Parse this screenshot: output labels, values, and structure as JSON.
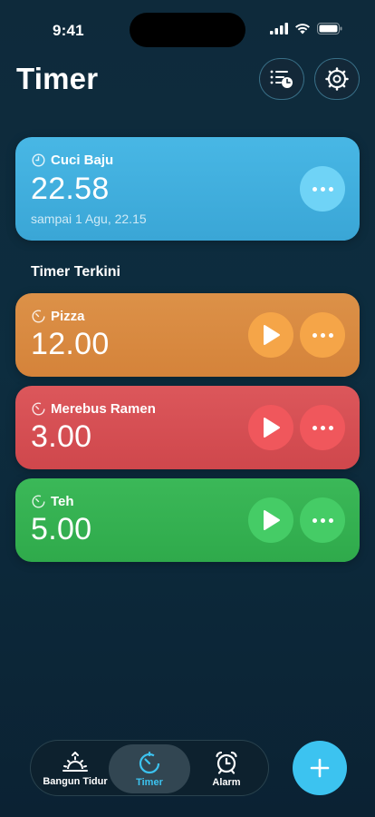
{
  "status_bar": {
    "time": "9:41"
  },
  "header": {
    "title": "Timer"
  },
  "active_timer": {
    "label": "Cuci Baju",
    "value": "22.58",
    "until": "sampai 1 Agu, 22.15",
    "color": "#3aa6d6"
  },
  "recent": {
    "title": "Timer Terkini",
    "items": [
      {
        "label": "Pizza",
        "value": "12.00",
        "color": "#d88a3e"
      },
      {
        "label": "Merebus Ramen",
        "value": "3.00",
        "color": "#d64d52"
      },
      {
        "label": "Teh",
        "value": "5.00",
        "color": "#34b04f"
      }
    ]
  },
  "tabbar": {
    "tabs": [
      {
        "label": "Bangun Tidur",
        "icon": "sunrise-icon"
      },
      {
        "label": "Timer",
        "icon": "timer-icon",
        "active": true
      },
      {
        "label": "Alarm",
        "icon": "alarm-clock-icon"
      }
    ],
    "accent": "#3cc3f0"
  }
}
